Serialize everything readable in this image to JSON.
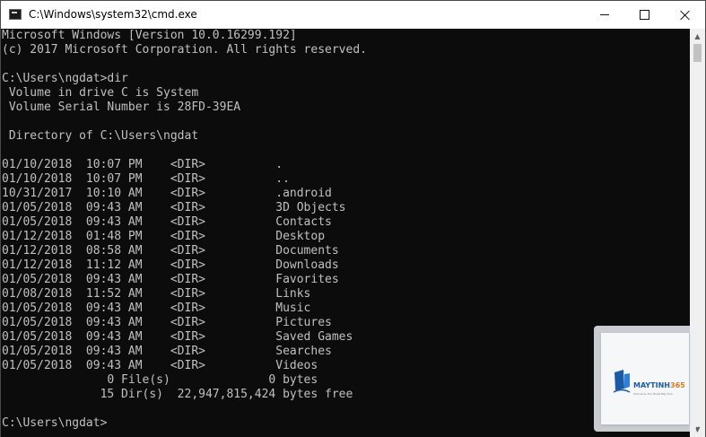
{
  "window": {
    "title": "C:\\Windows\\system32\\cmd.exe",
    "icon": "cmd-icon",
    "controls": [
      "minimize-icon",
      "maximize-icon",
      "close-icon"
    ]
  },
  "console": {
    "lines": [
      "Microsoft Windows [Version 10.0.16299.192]",
      "(c) 2017 Microsoft Corporation. All rights reserved.",
      "",
      "C:\\Users\\ngdat>dir",
      " Volume in drive C is System",
      " Volume Serial Number is 28FD-39EA",
      "",
      " Directory of C:\\Users\\ngdat",
      "",
      "01/10/2018  10:07 PM    <DIR>          .",
      "01/10/2018  10:07 PM    <DIR>          ..",
      "10/31/2017  10:10 AM    <DIR>          .android",
      "01/05/2018  09:43 AM    <DIR>          3D Objects",
      "01/05/2018  09:43 AM    <DIR>          Contacts",
      "01/12/2018  01:48 PM    <DIR>          Desktop",
      "01/12/2018  08:58 AM    <DIR>          Documents",
      "01/12/2018  11:12 AM    <DIR>          Downloads",
      "01/05/2018  09:43 AM    <DIR>          Favorites",
      "01/08/2018  11:52 AM    <DIR>          Links",
      "01/05/2018  09:43 AM    <DIR>          Music",
      "01/05/2018  09:43 AM    <DIR>          Pictures",
      "01/05/2018  09:43 AM    <DIR>          Saved Games",
      "01/05/2018  09:43 AM    <DIR>          Searches",
      "01/05/2018  09:43 AM    <DIR>          Videos",
      "               0 File(s)              0 bytes",
      "              15 Dir(s)  22,947,815,424 bytes free",
      "",
      "C:\\Users\\ngdat>"
    ],
    "text_color": "#c0c0c0",
    "background": "#0c0c0c"
  },
  "watermark": {
    "brand_main": "MAYTINH",
    "brand_accent": "365",
    "tagline": "Chia sẻ & Thủ thuật Máy tính",
    "brand_color": "#1a5aa8",
    "accent_color": "#e07a1f"
  }
}
